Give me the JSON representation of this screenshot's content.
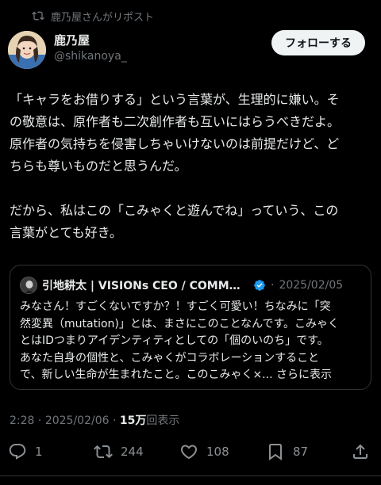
{
  "repost": {
    "label": "鹿乃屋さんがリポスト",
    "icon": "repost-icon"
  },
  "author": {
    "name": "鹿乃屋",
    "handle": "@shikanoya_"
  },
  "follow_button": "フォローする",
  "post": {
    "lines": [
      "「キャラをお借りする」という言葉が、生理的に嫌い。そ",
      "の敬意は、原作者も二次創作者も互いにはらうべきだよ。",
      "原作者の気持ちを侵害しちゃいけないのは前提だけど、ど",
      "ちらも尊いものだと思うんだ。",
      "",
      "だから、私はこの「こみゃくと遊んでね」っていう、この",
      "言葉がとても好き。"
    ]
  },
  "quote": {
    "name": "引地耕太 | VISIONs CEO / COMMON…",
    "separator": "·",
    "date": "2025/02/05",
    "lines": [
      "みなさん！すごくないですか？！すごく可愛い！ちなみに「突",
      "然変異（mutation)」とは、まさにこのことなんです。こみゃく",
      "とはIDつまりアイデンティティとしての「個のいのち」です。",
      "あなた自身の個性と、こみゃくがコラボレーションすること",
      "で、新しい生命が生まれたこと。このこみゃく×..."
    ],
    "more": "さらに表示"
  },
  "meta": {
    "time": "2:28",
    "separator": "·",
    "date": "2025/02/06",
    "views_count": "15万",
    "views_label": "回表示"
  },
  "actions": {
    "replies": "1",
    "reposts": "244",
    "likes": "108",
    "bookmarks": "87"
  },
  "colors": {
    "background": "#000000",
    "text": "#e7e9ea",
    "secondary": "#71767b",
    "verified": "#1d9bf0",
    "border": "#2f3336"
  }
}
